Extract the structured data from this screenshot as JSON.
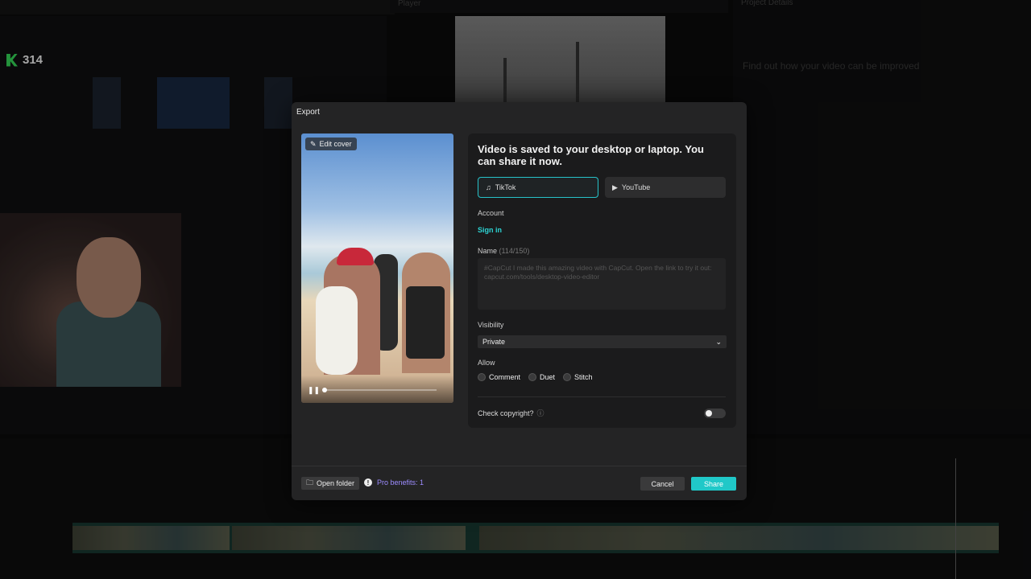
{
  "background": {
    "logo_count": "314",
    "player_label": "Player",
    "right_tabs": "Project   Details",
    "right_title": "Find out how your video can be improved"
  },
  "dialog": {
    "title": "Export",
    "edit_cover": "Edit cover",
    "share_title": "Video is saved to your desktop or laptop. You can share it now.",
    "platforms": [
      {
        "label": "TikTok",
        "selected": true
      },
      {
        "label": "YouTube",
        "selected": false
      }
    ],
    "account_label": "Account",
    "sign_in": "Sign in",
    "name_label": "Name",
    "name_count": "(114/150)",
    "name_value": "#CapCut I made this amazing video with CapCut. Open the link to try it out: capcut.com/tools/desktop-video-editor",
    "visibility_label": "Visibility",
    "visibility_value": "Private",
    "allow_label": "Allow",
    "allow_options": [
      "Comment",
      "Duet",
      "Stitch"
    ],
    "copyright_label": "Check copyright?",
    "open_folder": "Open folder",
    "pro_benefits": "Pro benefits: 1",
    "cancel": "Cancel",
    "share": "Share"
  },
  "colors": {
    "accent": "#20c8c8",
    "pro": "#9d8cff",
    "logo": "#38e25c"
  }
}
